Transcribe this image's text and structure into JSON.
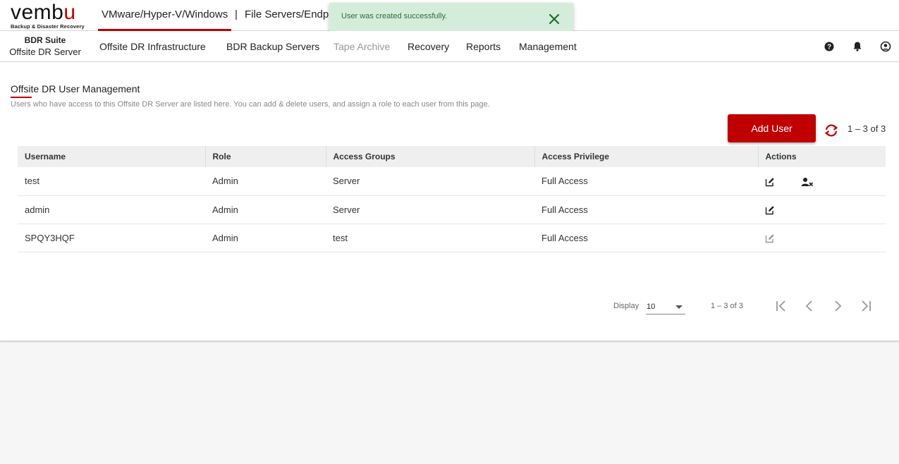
{
  "app": {
    "logo_main": "vemb",
    "logo_accent": "u",
    "logo_tagline": "Backup & Disaster Recovery",
    "brand_color": "#c00000"
  },
  "top_tabs": [
    {
      "label": "VMware/Hyper-V/Windows",
      "active": true
    },
    {
      "label": "File Servers/Endpoints",
      "active": false
    }
  ],
  "top_separator": "|",
  "toast": {
    "message": "User was created successfully.",
    "close_icon": "close-icon"
  },
  "product": {
    "suite": "BDR Suite",
    "name": "Offsite DR Server"
  },
  "nav": [
    {
      "label": "Offsite DR Infrastructure",
      "disabled": false
    },
    {
      "label": "BDR Backup Servers",
      "disabled": false
    },
    {
      "label": "Tape Archive",
      "disabled": true
    },
    {
      "label": "Recovery",
      "disabled": false
    },
    {
      "label": "Reports",
      "disabled": false
    },
    {
      "label": "Management",
      "disabled": false
    }
  ],
  "nav_icons": [
    "help-icon",
    "bell-icon",
    "user-icon"
  ],
  "page": {
    "title": "Offsite DR User Management",
    "description": "Users who have access to this Offsite DR Server are listed here. You can add & delete users, and assign a role to each user from this page.",
    "add_button": "Add User",
    "count": "1 – 3 of 3"
  },
  "table": {
    "columns": [
      "Username",
      "Role",
      "Access Groups",
      "Access Privilege",
      "Actions"
    ],
    "rows": [
      {
        "username": "test",
        "role": "Admin",
        "groups": "Server",
        "privilege": "Full Access",
        "can_delete": true,
        "edit_enabled": true
      },
      {
        "username": "admin",
        "role": "Admin",
        "groups": "Server",
        "privilege": "Full Access",
        "can_delete": false,
        "edit_enabled": true
      },
      {
        "username": "SPQY3HQF",
        "role": "Admin",
        "groups": "test",
        "privilege": "Full Access",
        "can_delete": false,
        "edit_enabled": false
      }
    ]
  },
  "pager": {
    "display_label": "Display",
    "page_size": "10",
    "count": "1 – 3 of 3"
  }
}
